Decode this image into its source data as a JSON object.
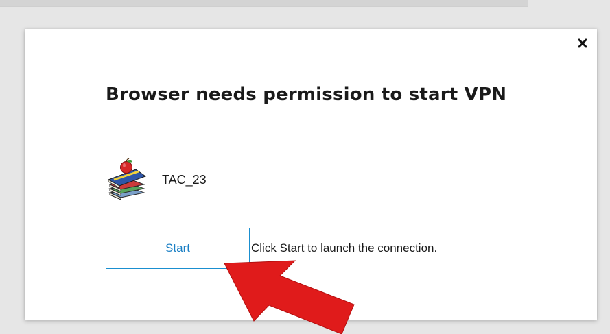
{
  "dialog": {
    "title": "Browser needs permission to start VPN",
    "close_label": "×",
    "app": {
      "name": "TAC_23",
      "icon": "books-apple-icon"
    },
    "start_button_label": "Start",
    "hint": "Click Start to launch the connection."
  },
  "annotation": {
    "arrow_color": "#e01b1b",
    "arrow_target": "start-button"
  },
  "colors": {
    "page_background": "#e6e6e6",
    "dialog_background": "#ffffff",
    "button_border": "#1a8fd0",
    "button_text": "#1a7fc4",
    "text": "#1a1a1a"
  }
}
